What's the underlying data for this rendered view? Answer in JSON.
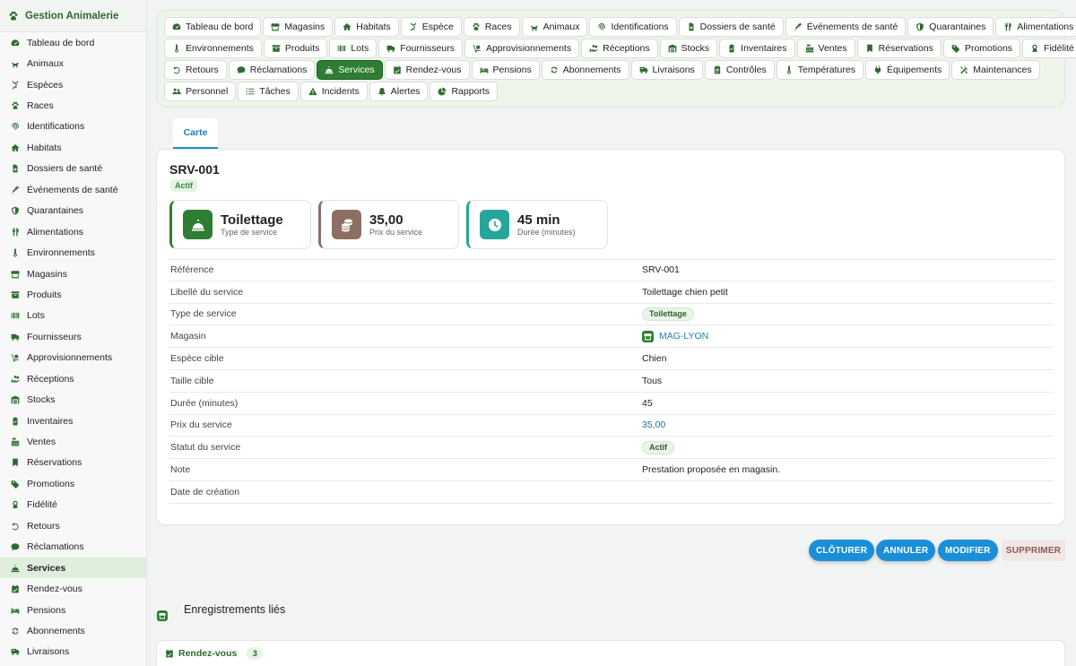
{
  "colors": {
    "primary": "#2e7d32",
    "accent": "#1a8fd8",
    "sidebar_bg": "#f7f8f7",
    "module_bg": "#eef6ec"
  },
  "app": {
    "title": "Gestion Animalerie",
    "icon": "paw-icon"
  },
  "sidebar": {
    "items": [
      {
        "label": "Tableau de bord",
        "icon": "dashboard-icon"
      },
      {
        "label": "Animaux",
        "icon": "animal-icon"
      },
      {
        "label": "Espèces",
        "icon": "dna-icon"
      },
      {
        "label": "Races",
        "icon": "paw-icon"
      },
      {
        "label": "Identifications",
        "icon": "fingerprint-icon"
      },
      {
        "label": "Habitats",
        "icon": "home-icon"
      },
      {
        "label": "Dossiers de santé",
        "icon": "medical-file-icon"
      },
      {
        "label": "Événements de santé",
        "icon": "syringe-icon"
      },
      {
        "label": "Quarantaines",
        "icon": "shield-icon"
      },
      {
        "label": "Alimentations",
        "icon": "utensils-icon"
      },
      {
        "label": "Environnements",
        "icon": "thermometer-icon"
      },
      {
        "label": "Magasins",
        "icon": "store-icon"
      },
      {
        "label": "Produits",
        "icon": "box-icon"
      },
      {
        "label": "Lots",
        "icon": "barcode-icon"
      },
      {
        "label": "Fournisseurs",
        "icon": "truck-icon"
      },
      {
        "label": "Approvisionnements",
        "icon": "dolly-icon"
      },
      {
        "label": "Réceptions",
        "icon": "receive-icon"
      },
      {
        "label": "Stocks",
        "icon": "warehouse-icon"
      },
      {
        "label": "Inventaires",
        "icon": "checklist-icon"
      },
      {
        "label": "Ventes",
        "icon": "cash-register-icon"
      },
      {
        "label": "Réservations",
        "icon": "bookmark-icon"
      },
      {
        "label": "Promotions",
        "icon": "tags-icon"
      },
      {
        "label": "Fidélité",
        "icon": "award-icon"
      },
      {
        "label": "Retours",
        "icon": "undo-icon"
      },
      {
        "label": "Réclamations",
        "icon": "comment-icon"
      },
      {
        "label": "Services",
        "icon": "bell-concierge-icon"
      },
      {
        "label": "Rendez-vous",
        "icon": "calendar-check-icon"
      },
      {
        "label": "Pensions",
        "icon": "bed-icon"
      },
      {
        "label": "Abonnements",
        "icon": "sync-icon"
      },
      {
        "label": "Livraisons",
        "icon": "shipping-icon"
      }
    ],
    "active_index": 25
  },
  "modules": {
    "rows": [
      [
        {
          "label": "Tableau de bord",
          "icon": "dashboard-icon"
        },
        {
          "label": "Magasins",
          "icon": "store-icon"
        },
        {
          "label": "Habitats",
          "icon": "home-icon"
        },
        {
          "label": "Espèce",
          "icon": "dna-icon"
        },
        {
          "label": "Races",
          "icon": "paw-icon"
        },
        {
          "label": "Animaux",
          "icon": "animal-icon"
        },
        {
          "label": "Identifications",
          "icon": "fingerprint-icon"
        },
        {
          "label": "Dossiers de santé",
          "icon": "medical-file-icon"
        },
        {
          "label": "Événements de santé",
          "icon": "syringe-icon"
        },
        {
          "label": "Quarantaines",
          "icon": "shield-icon"
        },
        {
          "label": "Alimentations",
          "icon": "utensils-icon"
        }
      ],
      [
        {
          "label": "Environnements",
          "icon": "thermometer-icon"
        },
        {
          "label": "Produits",
          "icon": "box-icon"
        },
        {
          "label": "Lots",
          "icon": "barcode-icon"
        },
        {
          "label": "Fournisseurs",
          "icon": "truck-icon"
        },
        {
          "label": "Approvisionnements",
          "icon": "dolly-icon"
        },
        {
          "label": "Réceptions",
          "icon": "receive-icon"
        },
        {
          "label": "Stocks",
          "icon": "warehouse-icon"
        },
        {
          "label": "Inventaires",
          "icon": "checklist-icon"
        },
        {
          "label": "Ventes",
          "icon": "cash-register-icon"
        },
        {
          "label": "Réservations",
          "icon": "bookmark-icon"
        },
        {
          "label": "Promotions",
          "icon": "tags-icon"
        },
        {
          "label": "Fidélité",
          "icon": "award-icon"
        }
      ],
      [
        {
          "label": "Retours",
          "icon": "undo-icon"
        },
        {
          "label": "Réclamations",
          "icon": "comment-icon"
        },
        {
          "label": "Services",
          "icon": "bell-concierge-icon",
          "active": true
        },
        {
          "label": "Rendez-vous",
          "icon": "calendar-check-icon"
        },
        {
          "label": "Pensions",
          "icon": "bed-icon"
        },
        {
          "label": "Abonnements",
          "icon": "sync-icon"
        },
        {
          "label": "Livraisons",
          "icon": "shipping-icon"
        },
        {
          "label": "Contrôles",
          "icon": "clipboard-icon"
        },
        {
          "label": "Températures",
          "icon": "thermometer-icon"
        },
        {
          "label": "Équipements",
          "icon": "plug-icon"
        },
        {
          "label": "Maintenances",
          "icon": "tools-icon"
        }
      ],
      [
        {
          "label": "Personnel",
          "icon": "users-icon"
        },
        {
          "label": "Tâches",
          "icon": "list-icon"
        },
        {
          "label": "Incidents",
          "icon": "warning-icon"
        },
        {
          "label": "Alertes",
          "icon": "bell-icon"
        },
        {
          "label": "Rapports",
          "icon": "chart-pie-icon"
        }
      ]
    ]
  },
  "tab": {
    "label": "Carte"
  },
  "record": {
    "title": "SRV-001",
    "status_badge": "Actif",
    "stats": [
      {
        "value": "Toilettage",
        "label": "Type de service",
        "icon": "bell-concierge-icon",
        "color": "#2e7d32",
        "border": "#2e7d32"
      },
      {
        "value": "35,00",
        "label": "Prix du service",
        "icon": "coins-icon",
        "color": "#8d6e63",
        "border": "#8d6e63"
      },
      {
        "value": "45 min",
        "label": "Durée (minutes)",
        "icon": "clock-icon",
        "color": "#26a69a",
        "border": "#26a69a"
      }
    ],
    "fields": [
      {
        "label": "Référence",
        "value": "SRV-001",
        "kind": "text"
      },
      {
        "label": "Libellé du service",
        "value": "Toilettage chien petit",
        "kind": "text"
      },
      {
        "label": "Type de service",
        "value": "Toilettage",
        "kind": "pill"
      },
      {
        "label": "Magasin",
        "value": "MAG-LYON",
        "kind": "link",
        "icon": "store-icon"
      },
      {
        "label": "Espèce cible",
        "value": "Chien",
        "kind": "text"
      },
      {
        "label": "Taille cible",
        "value": "Tous",
        "kind": "text"
      },
      {
        "label": "Durée (minutes)",
        "value": "45",
        "kind": "text"
      },
      {
        "label": "Prix du service",
        "value": "35,00",
        "kind": "number"
      },
      {
        "label": "Statut du service",
        "value": "Actif",
        "kind": "pill"
      },
      {
        "label": "Note",
        "value": "Prestation proposée en magasin.",
        "kind": "text"
      },
      {
        "label": "Date de création",
        "value": "",
        "kind": "text"
      }
    ]
  },
  "actions": {
    "close": "CLÔTURER",
    "cancel": "ANNULER",
    "edit": "MODIFIER",
    "delete": "SUPPRIMER"
  },
  "linked": {
    "title": "Enregistrements liés",
    "icon": "store-icon",
    "sections": [
      {
        "label": "Rendez-vous",
        "count": "3",
        "icon": "calendar-check-icon"
      }
    ]
  }
}
